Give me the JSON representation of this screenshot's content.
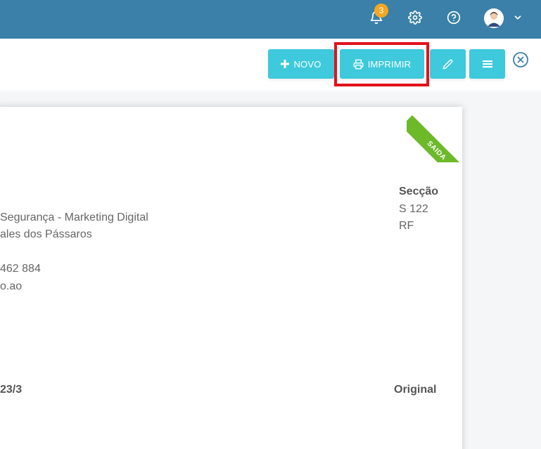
{
  "topbar": {
    "notification_count": "3"
  },
  "toolbar": {
    "new_label": "NOVO",
    "print_label": "IMPRIMIR"
  },
  "document": {
    "ribbon": "SAIDA",
    "address_line1": "Segurança - Marketing Digital",
    "address_line2": "ales dos Pássaros",
    "phone": "462 884",
    "email": "o.ao",
    "section_label": "Secção",
    "section_value1": "S 122",
    "section_value2": "RF",
    "doc_number": "23/3",
    "copy_type": "Original"
  },
  "colors": {
    "topbar": "#3a80a9",
    "button": "#3ec9dc",
    "highlight": "#e3121b",
    "ribbon": "#6cb92a",
    "badge": "#f5a623"
  }
}
